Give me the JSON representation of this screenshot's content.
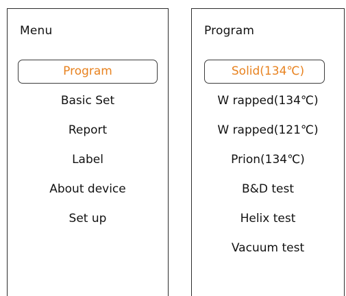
{
  "menu": {
    "title": "Menu",
    "items": [
      {
        "label": "Program"
      },
      {
        "label": "Basic Set"
      },
      {
        "label": "Report"
      },
      {
        "label": "Label"
      },
      {
        "label": "About device"
      },
      {
        "label": "Set up"
      }
    ]
  },
  "program": {
    "title": "Program",
    "items": [
      {
        "label": "Solid(134℃)"
      },
      {
        "label": "W rapped(134℃)"
      },
      {
        "label": "W rapped(121℃)"
      },
      {
        "label": "Prion(134℃)"
      },
      {
        "label": "B&D test"
      },
      {
        "label": "Helix test"
      },
      {
        "label": "Vacuum test"
      }
    ]
  },
  "colors": {
    "selected_text": "#e8821f",
    "border": "#2b2b2b"
  }
}
